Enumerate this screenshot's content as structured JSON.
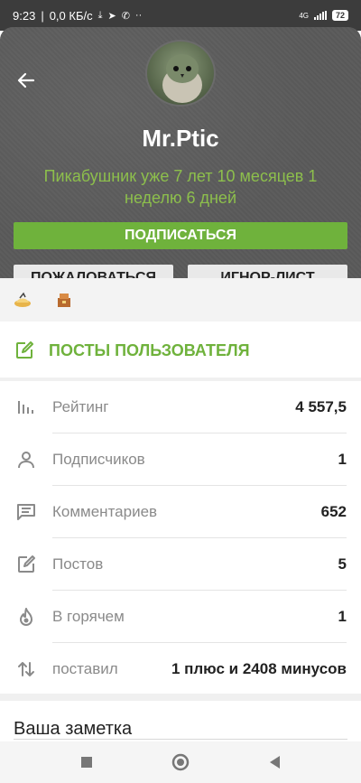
{
  "status_bar": {
    "time": "9:23",
    "net_speed": "0,0 КБ/с",
    "network": "4G",
    "battery": "72"
  },
  "profile": {
    "username": "Mr.Ptic",
    "since": "Пикабушник уже 7 лет 10 месяцев 1 неделю 6 дней",
    "subscribe_label": "ПОДПИСАТЬСЯ",
    "report_label": "ПОЖАЛОВАТЬСЯ",
    "ignore_label": "ИГНОР-ЛИСТ"
  },
  "posts_link": {
    "label": "ПОСТЫ ПОЛЬЗОВАТЕЛЯ"
  },
  "stats": [
    {
      "icon": "bar-chart-icon",
      "label": "Рейтинг",
      "value": "4 557,5"
    },
    {
      "icon": "person-icon",
      "label": "Подписчиков",
      "value": "1"
    },
    {
      "icon": "comment-icon",
      "label": "Комментариев",
      "value": "652"
    },
    {
      "icon": "edit-icon",
      "label": "Постов",
      "value": "5"
    },
    {
      "icon": "flame-icon",
      "label": "В горячем",
      "value": "1"
    },
    {
      "icon": "sort-arrows-icon",
      "label": "поставил",
      "value": "1 плюс и 2408 минусов"
    }
  ],
  "note": {
    "label": "Ваша заметка"
  },
  "colors": {
    "accent_green": "#6fb23c",
    "since_green": "#8dbf4c",
    "hero_bg": "#5a5a5a"
  }
}
